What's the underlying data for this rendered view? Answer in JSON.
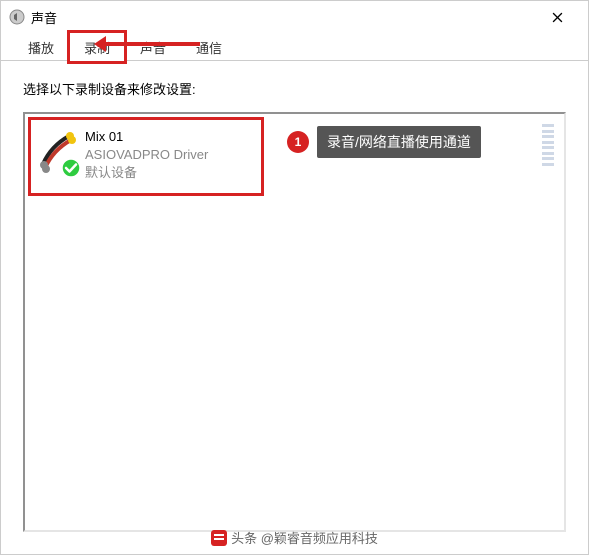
{
  "titlebar": {
    "title": "声音"
  },
  "tabs": [
    {
      "label": "播放"
    },
    {
      "label": "录制"
    },
    {
      "label": "声音"
    },
    {
      "label": "通信"
    }
  ],
  "prompt": "选择以下录制设备来修改设置:",
  "device": {
    "name": "Mix 01",
    "driver": "ASIOVADPRO Driver",
    "status": "默认设备"
  },
  "annotation": {
    "badge": "1",
    "label": "录音/网络直播使用通道"
  },
  "footer": {
    "text": "头条 @颖睿音频应用科技"
  }
}
